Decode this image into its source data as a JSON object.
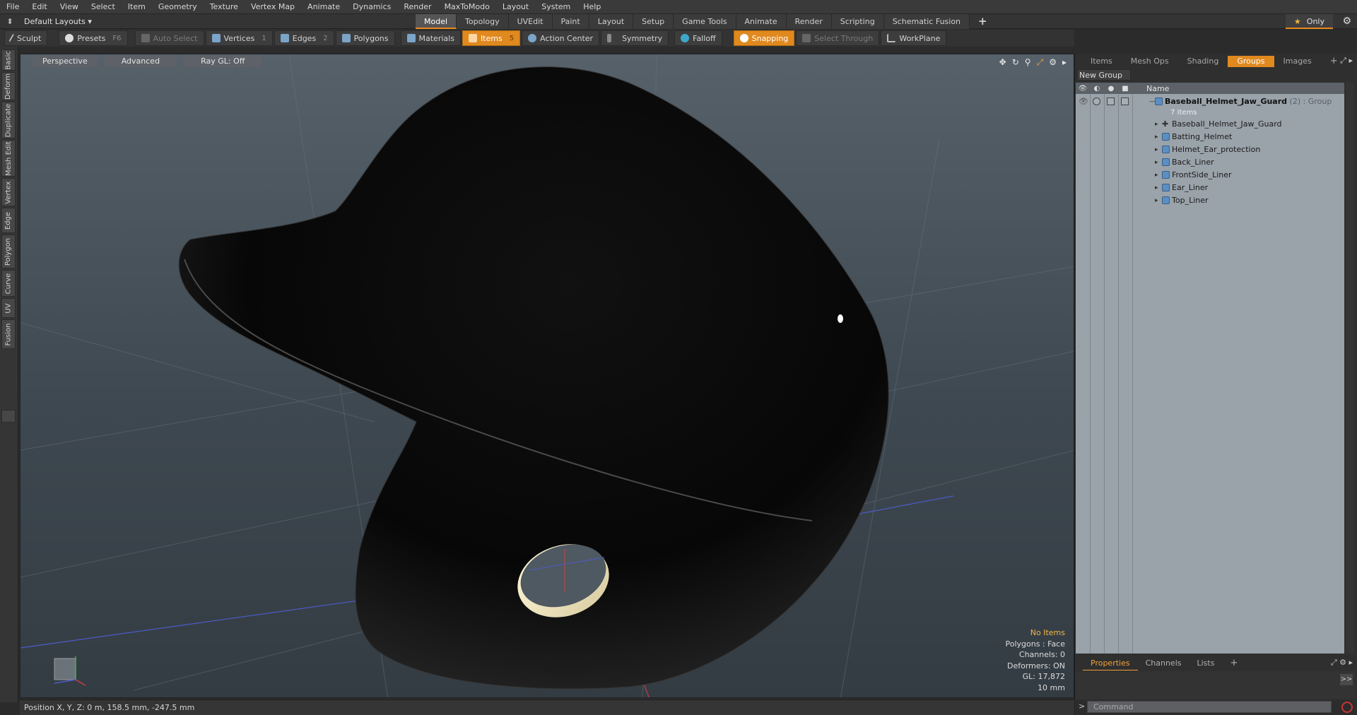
{
  "menu": [
    "File",
    "Edit",
    "View",
    "Select",
    "Item",
    "Geometry",
    "Texture",
    "Vertex Map",
    "Animate",
    "Dynamics",
    "Render",
    "MaxToModo",
    "Layout",
    "System",
    "Help"
  ],
  "layout": {
    "selector": "Default Layouts",
    "tabs": [
      "Model",
      "Topology",
      "UVEdit",
      "Paint",
      "Layout",
      "Setup",
      "Game Tools",
      "Animate",
      "Render",
      "Scripting",
      "Schematic Fusion"
    ],
    "active_tab": "Model",
    "only_label": "Only"
  },
  "toolbar": {
    "sculpt": "Sculpt",
    "presets": "Presets",
    "presets_key": "F6",
    "auto_select": "Auto Select",
    "vertices": "Vertices",
    "vertices_key": "1",
    "edges": "Edges",
    "edges_key": "2",
    "polygons": "Polygons",
    "materials": "Materials",
    "items": "Items",
    "items_key": "5",
    "action_center": "Action Center",
    "symmetry": "Symmetry",
    "falloff": "Falloff",
    "snapping": "Snapping",
    "select_through": "Select Through",
    "workplane": "WorkPlane"
  },
  "left_tabs": [
    "Basic",
    "Deform",
    "Duplicate",
    "Mesh Edit",
    "Vertex",
    "Edge",
    "Polygon",
    "Curve",
    "UV",
    "Fusion"
  ],
  "viewport": {
    "view": "Perspective",
    "shading": "Advanced",
    "raygl": "Ray GL: Off",
    "info": {
      "no_items": "No Items",
      "polygons": "Polygons : Face",
      "channels": "Channels: 0",
      "deformers": "Deformers: ON",
      "gl": "GL: 17,872",
      "unit": "10 mm"
    }
  },
  "status": {
    "position": "Position X, Y, Z:  0 m, 158.5 mm, -247.5 mm"
  },
  "right_panel": {
    "tabs": [
      "Items",
      "Mesh Ops",
      "Shading",
      "Groups",
      "Images"
    ],
    "active_tab": "Groups",
    "new_group": "New Group",
    "column_name": "Name",
    "group": {
      "name": "Baseball_Helmet_Jaw_Guard",
      "meta": "(2) : Group",
      "count": "7 Items",
      "children": [
        "Baseball_Helmet_Jaw_Guard",
        "Batting_Helmet",
        "Helmet_Ear_protection",
        "Back_Liner",
        "FrontSide_Liner",
        "Ear_Liner",
        "Top_Liner"
      ]
    },
    "bottom_tabs": [
      "Properties",
      "Channels",
      "Lists"
    ],
    "bottom_active": "Properties",
    "command_placeholder": "Command"
  },
  "colors": {
    "accent": "#e0891f",
    "helmet": "#070707",
    "viewport_top": "#56616a",
    "groups_bg": "#9aa2aa"
  }
}
